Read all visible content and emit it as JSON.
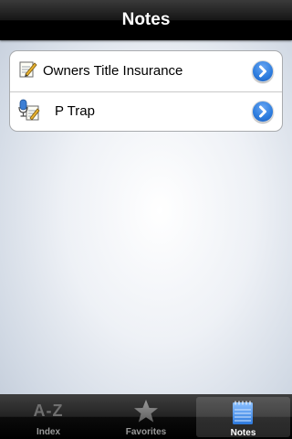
{
  "navbar": {
    "title": "Notes"
  },
  "notes": [
    {
      "title": "Owners Title Insurance",
      "icon": "note-pencil-icon"
    },
    {
      "title": "P Trap",
      "icon": "voice-note-icon"
    }
  ],
  "tabbar": {
    "tabs": [
      {
        "label": "Index",
        "glyph": "A-Z",
        "icon": "az-icon",
        "selected": false
      },
      {
        "label": "Favorites",
        "icon": "star-icon",
        "selected": false
      },
      {
        "label": "Notes",
        "icon": "notepad-icon",
        "selected": true
      }
    ]
  },
  "colors": {
    "accent": "#2f7fe0",
    "selected_tab": "#4a90e2"
  }
}
